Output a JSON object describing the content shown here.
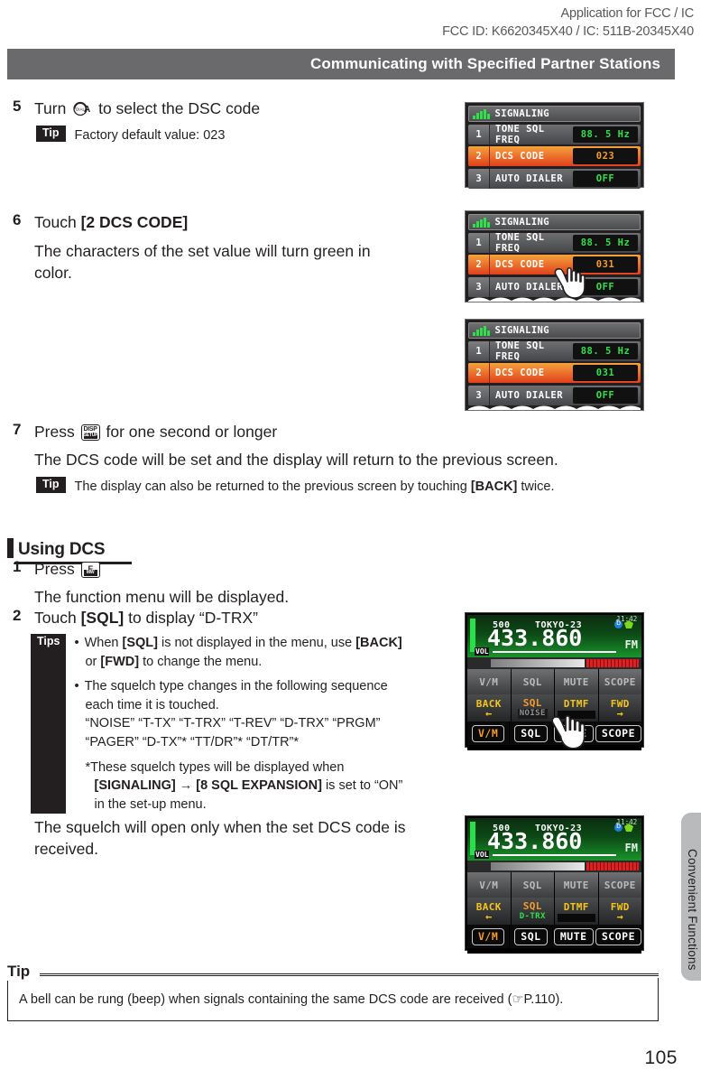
{
  "header": {
    "line1": "Application for FCC /  IC",
    "line2": "FCC ID: K6620345X40 /  IC: 511B-20345X40"
  },
  "banner": {
    "title": "Communicating with Specified Partner Stations"
  },
  "steps": {
    "s5": {
      "num": "5",
      "text_before": "Turn",
      "text_after": "to select the DSC code",
      "tip_badge": "Tip",
      "tip_text": "Factory default value: 023"
    },
    "s6": {
      "num": "6",
      "text_before": "Touch",
      "bold": "[2 DCS CODE]",
      "detail_l1": "The characters of the set value will turn green in",
      "detail_l2": "color."
    },
    "s7": {
      "num": "7",
      "text_before": "Press",
      "text_after": "for one second or longer",
      "detail": "The DCS code will be set and the display will return to the previous screen.",
      "tip_badge": "Tip",
      "tip_a": "The display can also be returned to the previous screen by touching ",
      "tip_bold": "[BACK]",
      "tip_b": " twice."
    }
  },
  "section": {
    "title": "Using DCS"
  },
  "dcs_steps": {
    "s1": {
      "num": "1",
      "text_before": "Press",
      "detail": "The function menu will be displayed."
    },
    "s2": {
      "num": "2",
      "text_before": "Touch",
      "bold": "[SQL]",
      "text_after": "to display “D-TRX”",
      "tips_badge": "Tips",
      "b1_a": "When ",
      "b1_bold1": "[SQL]",
      "b1_b": " is not displayed in the menu, use ",
      "b1_bold2": "[BACK]",
      "b1_c": "or ",
      "b1_bold3": "[FWD]",
      "b1_d": " to change the menu.",
      "b2_l1": "The squelch type changes in the following sequence",
      "b2_l2": "each time it is touched.",
      "b2_l3": "“NOISE” “T-TX” “T-TRX” “T-REV” “D-TRX” “PRGM”",
      "b2_l4": "“PAGER” “D-TX”* “TT/DR”* “DT/TR”*",
      "note_l1": "*These squelch types will be displayed when",
      "note_bold1": "[SIGNALING]",
      "note_arrow": "→",
      "note_bold2": "[8 SQL EXPANSION]",
      "note_l2b": " is set to “ON”",
      "note_l3": "in the set-up menu.",
      "closing_l1": "The squelch will open only when the set DCS code is",
      "closing_l2": "received."
    }
  },
  "lcd_signaling": {
    "header_title": "SIGNALING",
    "signal_icon": "signal-bars-icon",
    "rows_a": [
      {
        "idx": "1",
        "label": "TONE SQL FREQ",
        "value": "88. 5 Hz",
        "style": "grey"
      },
      {
        "idx": "2",
        "label": "DCS CODE",
        "value": "023",
        "style": "orange"
      },
      {
        "idx": "3",
        "label": "AUTO DIALER",
        "value": "OFF",
        "style": "grey"
      }
    ],
    "rows_b": [
      {
        "idx": "1",
        "label": "TONE SQL FREQ",
        "value": "88. 5 Hz",
        "style": "grey"
      },
      {
        "idx": "2",
        "label": "DCS CODE",
        "value": "031",
        "style": "orange"
      },
      {
        "idx": "3",
        "label": "AUTO DIALER",
        "value": "OFF",
        "style": "grey"
      }
    ],
    "rows_c": [
      {
        "idx": "1",
        "label": "TONE SQL FREQ",
        "value": "88. 5 Hz",
        "style": "grey"
      },
      {
        "idx": "2",
        "label": "DCS CODE",
        "value": "031",
        "style": "orange-green"
      },
      {
        "idx": "3",
        "label": "AUTO DIALER",
        "value": "OFF",
        "style": "grey"
      }
    ]
  },
  "radio": {
    "time": "11:42",
    "channel": "500",
    "name": "TOKYO-23",
    "freq": "433.860",
    "mode": "FM",
    "vol_label": "VOL",
    "row1": [
      "V/M",
      "SQL",
      "MUTE",
      "SCOPE"
    ],
    "row2_top": [
      "BACK",
      "SQL",
      "DTMF",
      "FWD"
    ],
    "row2_arrows": [
      "←",
      "",
      "",
      "→"
    ],
    "row3": [
      "V/M",
      "SQL",
      "MUTE",
      "SCOPE"
    ],
    "sql_sub_first": "NOISE",
    "sql_sub_second": "D-TRX"
  },
  "tipbox": {
    "label": "Tip",
    "text_a": "A bell can be rung (beep) when signals containing the same DCS code are received (",
    "ref": "P.110",
    "text_b": ")."
  },
  "sidebar": {
    "tab_label": "Convenient Functions"
  },
  "page": {
    "number": "105"
  }
}
